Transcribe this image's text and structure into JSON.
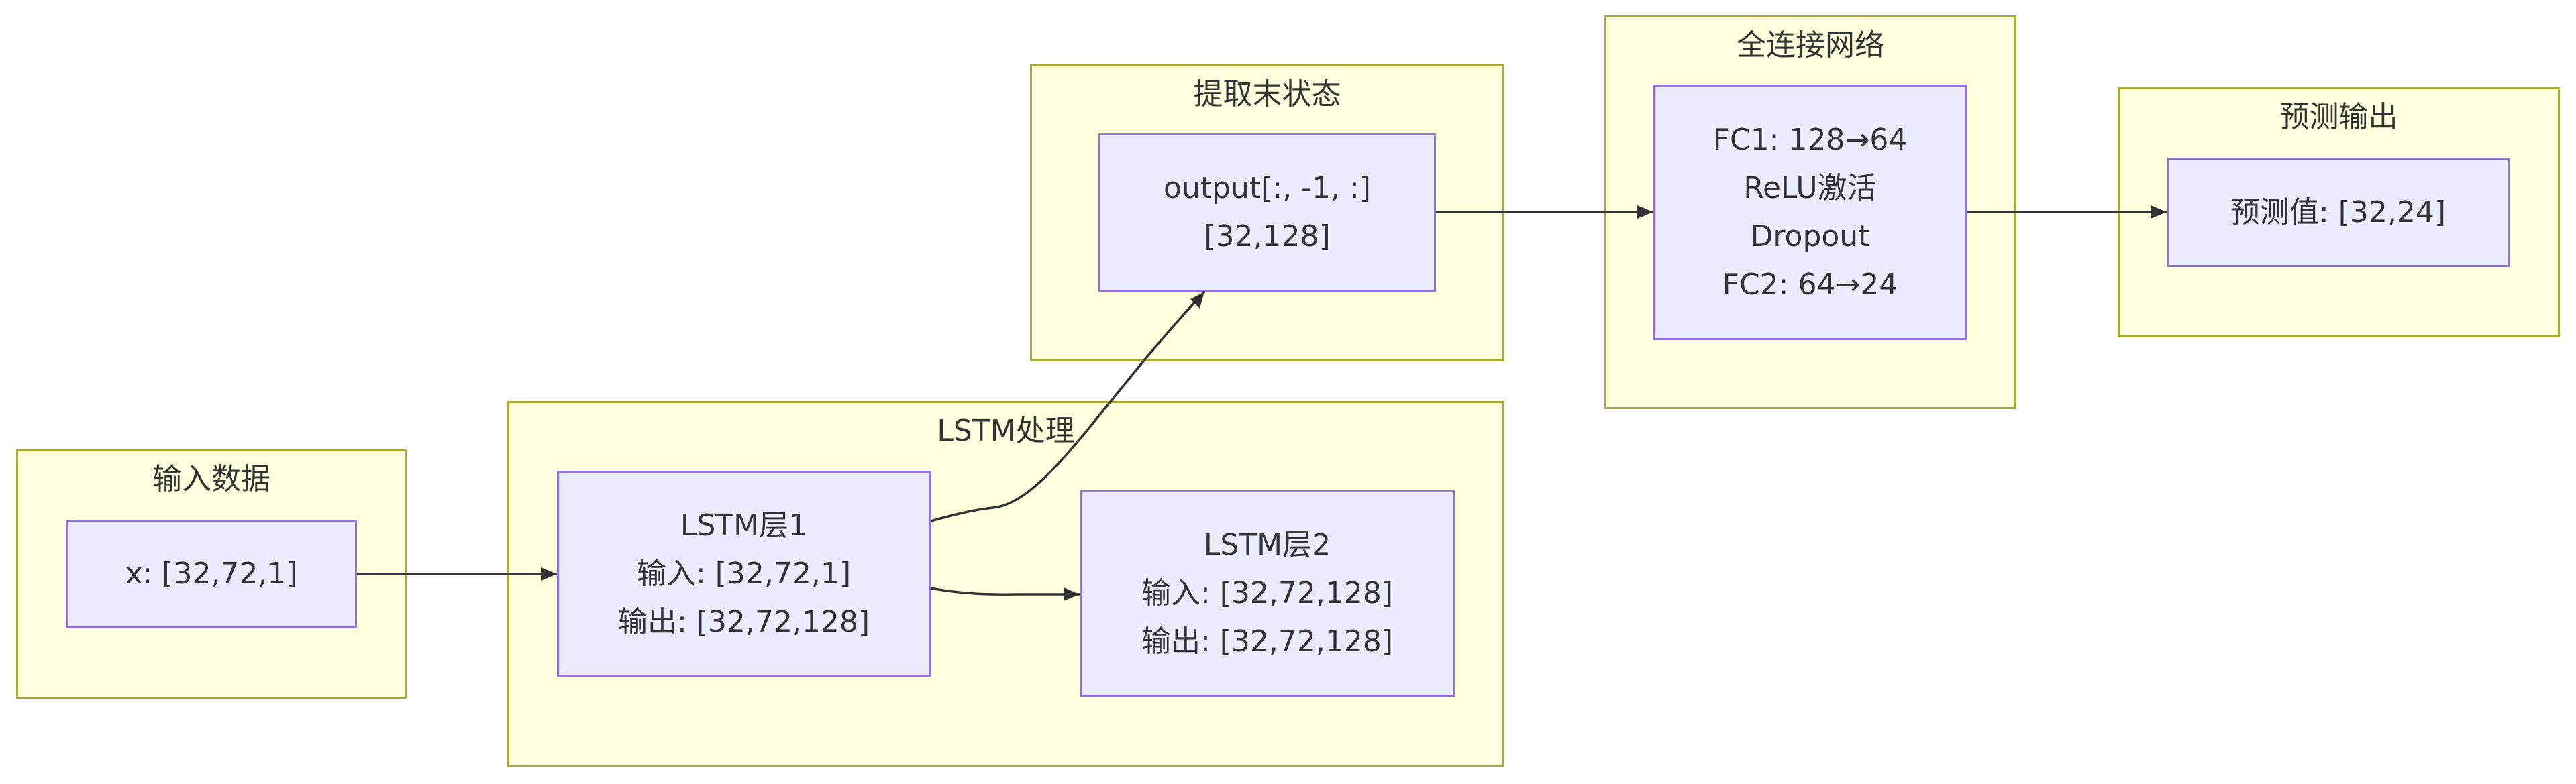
{
  "clusters": {
    "input": {
      "title": "输入数据"
    },
    "lstm": {
      "title": "LSTM处理"
    },
    "extract": {
      "title": "提取末状态"
    },
    "fc": {
      "title": "全连接网络"
    },
    "pred": {
      "title": "预测输出"
    }
  },
  "nodes": {
    "x": {
      "lines": [
        "x: [32,72,1]"
      ]
    },
    "lstm1": {
      "lines": [
        "LSTM层1",
        "输入: [32,72,1]",
        "输出: [32,72,128]"
      ]
    },
    "lstm2": {
      "lines": [
        "LSTM层2",
        "输入: [32,72,128]",
        "输出: [32,72,128]"
      ]
    },
    "last": {
      "lines": [
        "output[:, -1, :]",
        "[32,128]"
      ]
    },
    "fc": {
      "lines": [
        "FC1: 128→64",
        "ReLU激活",
        "Dropout",
        "FC2: 64→24"
      ]
    },
    "pred": {
      "lines": [
        "预测值: [32,24]"
      ]
    }
  },
  "edges": [
    {
      "from": "x",
      "to": "lstm1"
    },
    {
      "from": "lstm1",
      "to": "lstm2"
    },
    {
      "from": "lstm1",
      "to": "last"
    },
    {
      "from": "last",
      "to": "fc"
    },
    {
      "from": "fc",
      "to": "pred"
    }
  ],
  "colors": {
    "cluster_fill": "#ffffde",
    "cluster_border": "#aaaa33",
    "node_fill": "#ececff",
    "node_border": "#9370db",
    "text": "#333333",
    "edge": "#333333"
  }
}
